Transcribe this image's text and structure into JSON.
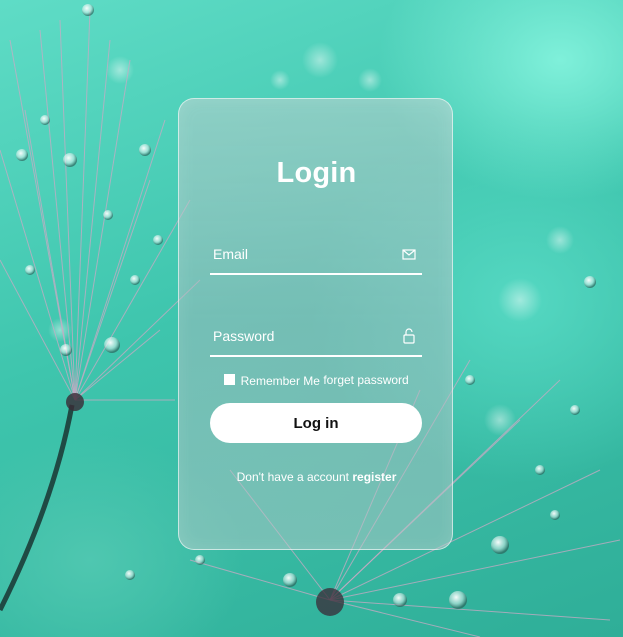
{
  "background": {
    "description_icon": "dandelion-dew-photo",
    "dominant_color": "#3ec5ad"
  },
  "login_form": {
    "title": "Login",
    "email": {
      "placeholder": "Email",
      "value": "",
      "icon": "envelope-icon"
    },
    "password": {
      "placeholder": "Password",
      "value": "",
      "icon": "lock-icon"
    },
    "remember_me_label": "Remember Me",
    "remember_me_checked": false,
    "forgot_password_label": "forget password",
    "submit_label": "Log in",
    "register_prompt": "Don't have a account",
    "register_link": "register"
  },
  "colors": {
    "text": "#ffffff",
    "button_bg": "#ffffff",
    "button_text": "#111111"
  }
}
